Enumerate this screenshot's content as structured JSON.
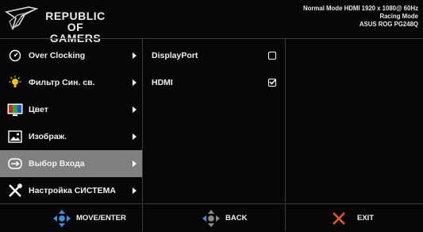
{
  "header": {
    "brand_line1": "REPUBLIC OF",
    "brand_line2": "GAMERS",
    "status_line1": "Normal Mode HDMI 1920 x 1080@ 60Hz",
    "status_line2": "Racing Mode",
    "status_line3": "ASUS ROG PG248Q"
  },
  "main_menu": {
    "items": [
      {
        "label": "Over Clocking",
        "icon": "speedometer-icon"
      },
      {
        "label": "Фильтр Син. св.",
        "icon": "blue-light-bulb-icon"
      },
      {
        "label": "Цвет",
        "icon": "color-icon"
      },
      {
        "label": "Изображ.",
        "icon": "image-icon"
      },
      {
        "label": "Выбор Входа",
        "icon": "input-select-icon",
        "selected": true
      },
      {
        "label": "Настройка СИСТЕМА",
        "icon": "system-tools-icon"
      }
    ]
  },
  "submenu": {
    "items": [
      {
        "label": "DisplayPort",
        "checked": false
      },
      {
        "label": "HDMI",
        "checked": true
      }
    ]
  },
  "footer": {
    "move_label": "MOVE/ENTER",
    "back_label": "BACK",
    "exit_label": "EXIT"
  },
  "colors": {
    "background": "#060606",
    "selected_row": "#808080",
    "divider": "#3a3a3a",
    "dpad_blue": "#3c8fe0",
    "exit_x": "#e85a2a"
  }
}
